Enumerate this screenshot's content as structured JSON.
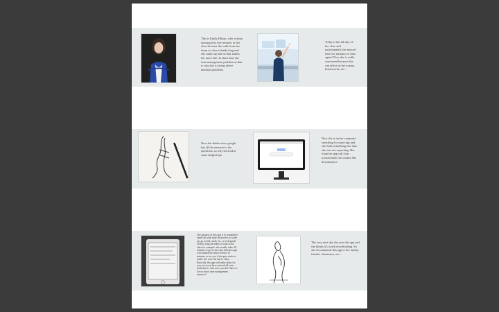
{
  "document": {
    "texts": {
      "t1": "This is Emily Hilson, who is keep missing first five minutes of her class because the walk from her dorm to class is kinda long and she wakes up late so that makes her more late. In short time she time management problem as that is why she is facing above mention problems.",
      "t2": "Today is the 4th day of her class and unfortunately she missed first few minutes of class again! Now she is really concerned because this can affect on her exams, homeworks, etc...",
      "t3": "Now she thinks since google has all the answers to the questions, so why not look it some helpful tips",
      "t4": "Now she is on her computer searching for some tips and she finds something else that she was not expecting. She found an app call class tracker/daily life tracker She downloads it.",
      "t5": "The purpose of this app is to remind her based on what time she prefers to wake up, go to bed, study etc., so it depends on how long she takes to walk to the class for example: she usually takes 10 minutes to get to the class then this app will remind her before before 15 minutes, as in case if she gets stuck in traffic she won't be late to class. Basically this app will make plans for you, once you have entered all your preferences. And now you don't have to worry about time management anymore!",
      "t6": "The very next day she uses this app and she thinks it's worth downloading. So she recommends this app to her family, friends, classmates, etc..."
    }
  },
  "colors": {
    "viewer_bg": "#3b3b3b",
    "page_bg": "#ffffff",
    "band_bg": "#e7eaea"
  }
}
